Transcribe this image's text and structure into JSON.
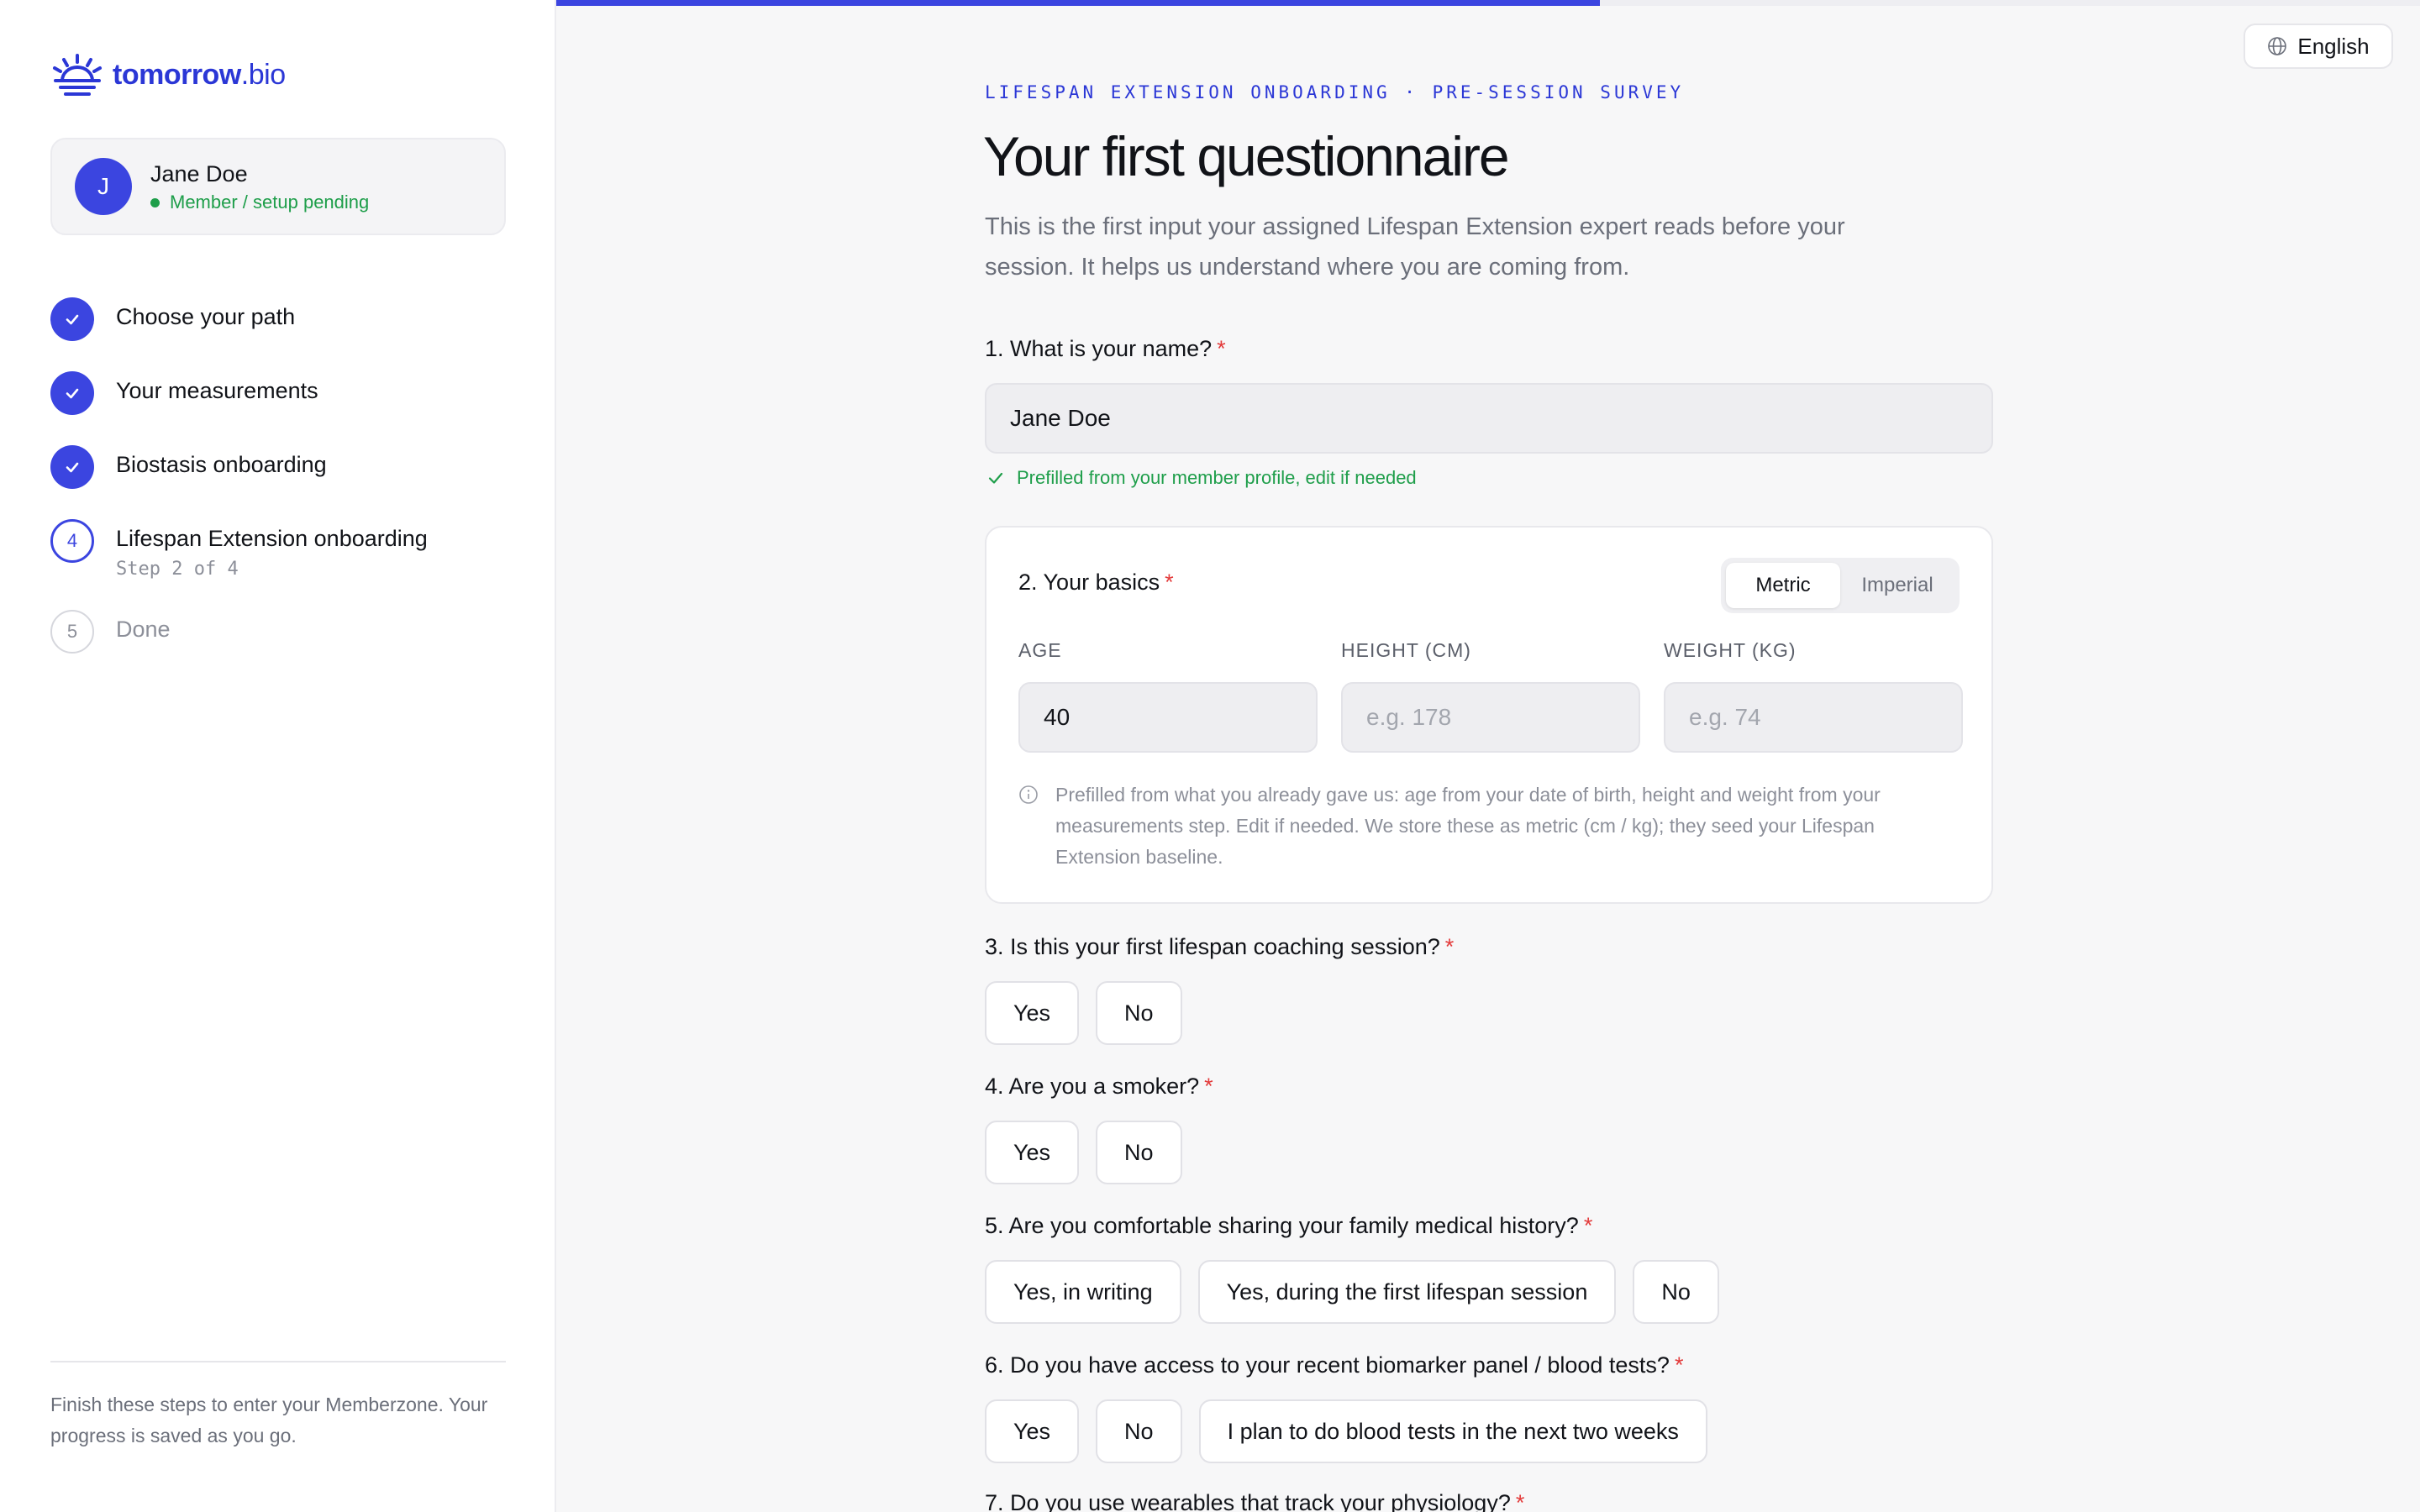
{
  "brand": {
    "name_bold": "tomorrow",
    "name_light": ".bio"
  },
  "user": {
    "initial": "J",
    "name": "Jane Doe",
    "status": "Member / setup pending"
  },
  "steps": [
    {
      "label": "Choose your path",
      "state": "done"
    },
    {
      "label": "Your measurements",
      "state": "done"
    },
    {
      "label": "Biostasis onboarding",
      "state": "done"
    },
    {
      "number": "4",
      "label": "Lifespan Extension onboarding",
      "sub": "Step 2 of 4",
      "state": "active"
    },
    {
      "number": "5",
      "label": "Done",
      "state": "pending"
    }
  ],
  "sidebar_footer": "Finish these steps to enter your Memberzone. Your progress is saved as you go.",
  "progress": {
    "fraction": 0.56
  },
  "language": "English",
  "eyebrow": "LIFESPAN EXTENSION ONBOARDING · PRE-SESSION SURVEY",
  "title": "Your first questionnaire",
  "intro": "This is the first input your assigned Lifespan Extension expert reads before your session. It helps us understand where you are coming from.",
  "required_mark": "*",
  "q1": {
    "label": "1. What is your name?",
    "value": "Jane Doe",
    "hint": "Prefilled from your member profile, edit if needed"
  },
  "q2": {
    "label": "2. Your basics",
    "units": [
      "Metric",
      "Imperial"
    ],
    "selected_unit": "Metric",
    "age_label": "AGE",
    "age_value": "40",
    "height_label": "HEIGHT (CM)",
    "height_placeholder": "e.g. 178",
    "weight_label": "WEIGHT (KG)",
    "weight_placeholder": "e.g. 74",
    "note": "Prefilled from what you already gave us: age from your date of birth, height and weight from your measurements step. Edit if needed. We store these as metric (cm / kg); they seed your Lifespan Extension baseline."
  },
  "q3": {
    "label": "3. Is this your first lifespan coaching session?",
    "options": [
      "Yes",
      "No"
    ]
  },
  "q4": {
    "label": "4. Are you a smoker?",
    "options": [
      "Yes",
      "No"
    ]
  },
  "q5": {
    "label": "5. Are you comfortable sharing your family medical history?",
    "options": [
      "Yes, in writing",
      "Yes, during the first lifespan session",
      "No"
    ]
  },
  "q6": {
    "label": "6. Do you have access to your recent biomarker panel / blood tests?",
    "options": [
      "Yes",
      "No",
      "I plan to do blood tests in the next two weeks"
    ]
  },
  "q7": {
    "label": "7. Do you use wearables that track your physiology?"
  },
  "colors": {
    "accent": "#3b45e0",
    "success": "#1e9e4a",
    "required": "#e33b3b"
  }
}
